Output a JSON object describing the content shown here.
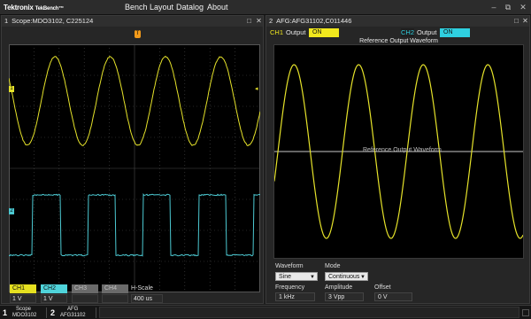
{
  "app": {
    "brand": "Tektronix",
    "brand_sub": "TekBench™"
  },
  "menu": [
    "Bench Layout",
    "Datalog",
    "About"
  ],
  "window_controls": {
    "minimize": "–",
    "restore": "⧉",
    "close": "✕"
  },
  "scope_panel": {
    "number": "1",
    "title": "Scope:MDO3102, C225124",
    "channels": [
      {
        "label": "CH1",
        "value": "1 V",
        "color": "#e5e020"
      },
      {
        "label": "CH2",
        "value": "1 V",
        "color": "#4fd3da"
      },
      {
        "label": "CH3",
        "value": "",
        "color": "#6a6a6a"
      },
      {
        "label": "CH4",
        "value": "",
        "color": "#6a6a6a"
      }
    ],
    "hscale_label": "H-Scale",
    "hscale_value": "400 us",
    "ch1_marker": "1",
    "ch2_marker": "2",
    "trigger_marker": "T",
    "colors": {
      "ch1": "#e6e32a",
      "ch2": "#4cc9d2",
      "grid": "#4a4a4a",
      "trigger": "#f29a1a"
    }
  },
  "afg_panel": {
    "number": "2",
    "title": "AFG:AFG31102,C011446",
    "ch1": {
      "label": "CH1",
      "output_label": "Output",
      "state": "ON",
      "color": "#f1e81d"
    },
    "ch2": {
      "label": "CH2",
      "output_label": "Output",
      "state": "ON",
      "color": "#2fd0e0"
    },
    "plot_title": "Reference Output Waveform",
    "plot_center_label": "Reference Output Waveform",
    "waveform": {
      "label": "Waveform",
      "value": "Sine"
    },
    "mode": {
      "label": "Mode",
      "value": "Continuous"
    },
    "frequency": {
      "label": "Frequency",
      "value": "1 kHz"
    },
    "amplitude": {
      "label": "Amplitude",
      "value": "3 Vpp"
    },
    "offset": {
      "label": "Offset",
      "value": "0 V"
    },
    "colors": {
      "wave": "#e6e32a",
      "axis": "#c8c8c8"
    }
  },
  "taskbar": [
    {
      "num": "1",
      "line1": "Scope",
      "line2": "MDO3102"
    },
    {
      "num": "2",
      "line1": "AFG",
      "line2": "AFG31102"
    }
  ]
}
